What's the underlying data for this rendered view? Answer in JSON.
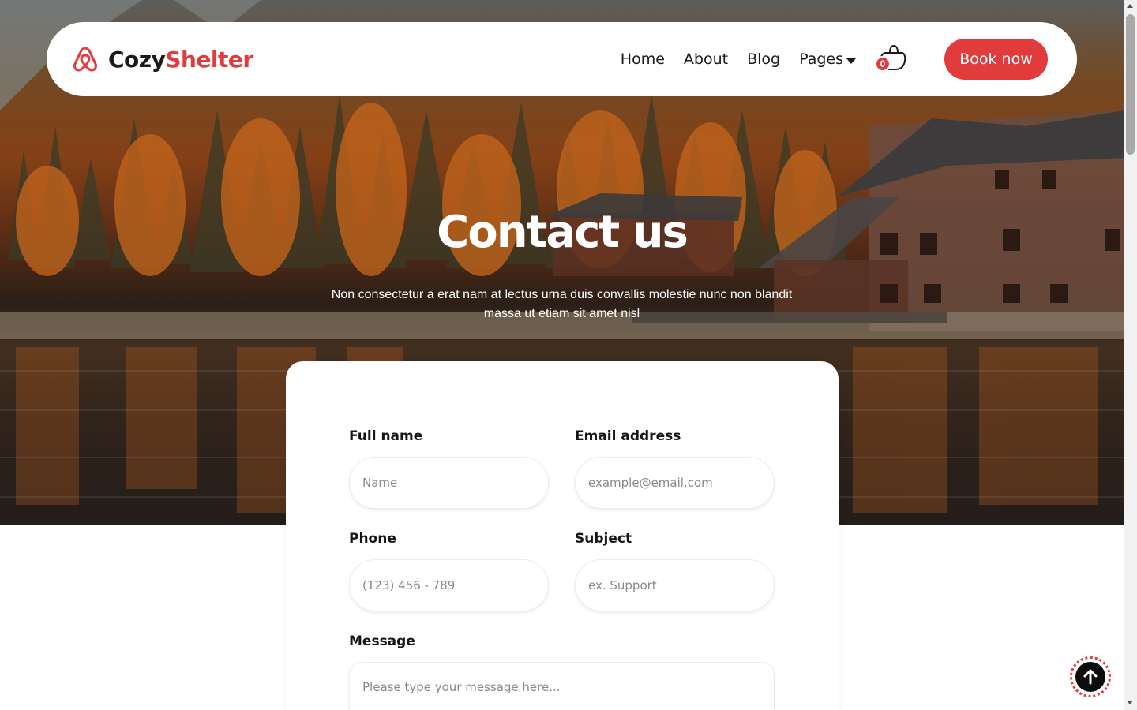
{
  "brand": {
    "name_part1": "Cozy",
    "name_part2": "Shelter"
  },
  "nav": {
    "items": [
      {
        "label": "Home"
      },
      {
        "label": "About"
      },
      {
        "label": "Blog"
      },
      {
        "label": "Pages"
      }
    ],
    "cart_count": "0",
    "cta_label": "Book now"
  },
  "hero": {
    "title": "Contact us",
    "subtitle": "Non consectetur a erat nam at lectus urna duis convallis molestie nunc non blandit massa ut etiam sit amet nisl"
  },
  "form": {
    "full_name": {
      "label": "Full name",
      "placeholder": "Name"
    },
    "email": {
      "label": "Email address",
      "placeholder": "example@email.com"
    },
    "phone": {
      "label": "Phone",
      "placeholder": "(123) 456 - 789"
    },
    "subject": {
      "label": "Subject",
      "placeholder": "ex. Support"
    },
    "message": {
      "label": "Message",
      "placeholder": "Please type your message here..."
    }
  },
  "colors": {
    "accent": "#e23b3b",
    "text": "#1a1a1a",
    "background": "#ffffff"
  },
  "icons": {
    "logo": "airbnb-style-logo-icon",
    "cart": "shopping-bag-icon",
    "scroll_top": "arrow-up-icon"
  }
}
